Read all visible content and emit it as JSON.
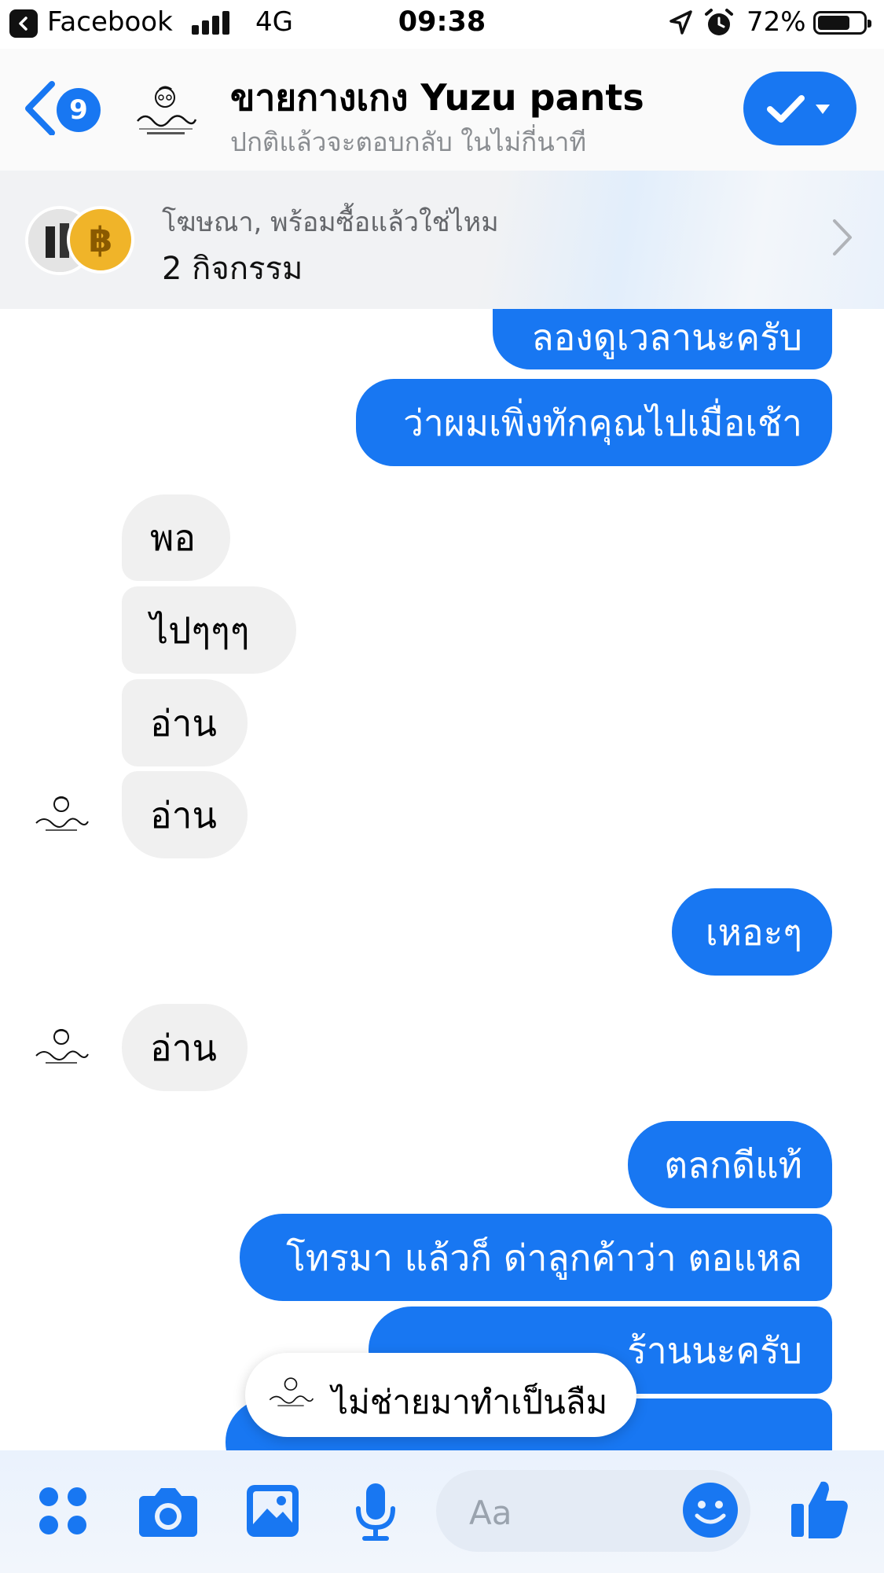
{
  "status_bar": {
    "back_app": "Facebook",
    "network": "4G",
    "time": "09:38",
    "battery": "72%",
    "battery_level": 0.72
  },
  "header": {
    "badge_count": "9",
    "page_name": "ขายกางเกง Yuzu pants",
    "page_status": "ปกติแล้วจะตอบกลับ ในไม่กี่นาที",
    "accent_color": "#1877f2"
  },
  "ad_banner": {
    "title": "โฆษณา, พร้อมซื้อแล้วใช่ไหม",
    "subtitle": "2 กิจกรรม",
    "coin_symbol": "฿"
  },
  "messages": [
    {
      "side": "out",
      "text": "ลองดูเวลานะครับ"
    },
    {
      "side": "out",
      "text": "ว่าผมเพิ่งทักคุณไปเมื่อเช้า"
    },
    {
      "side": "in",
      "text": "พอ"
    },
    {
      "side": "in",
      "text": "ไปๆๆๆ"
    },
    {
      "side": "in",
      "text": "อ่าน"
    },
    {
      "side": "in",
      "text": "อ่าน"
    },
    {
      "side": "out",
      "text": "เหอะๆ"
    },
    {
      "side": "in",
      "text": "อ่าน"
    },
    {
      "side": "out",
      "text": "ตลกดีแท้"
    },
    {
      "side": "out",
      "text": "โทรมา แล้วก็ ด่าลูกค้าว่า ตอแหล"
    },
    {
      "side": "out",
      "text": "ร้านนะครับ"
    }
  ],
  "toast": {
    "text": "ไม่ช่ายมาทำเป็นลืม"
  },
  "composer": {
    "placeholder": "Aa",
    "icons": [
      "menu-dots-icon",
      "camera-icon",
      "photo-icon",
      "microphone-icon",
      "emoji-icon",
      "thumbs-up-icon"
    ]
  }
}
